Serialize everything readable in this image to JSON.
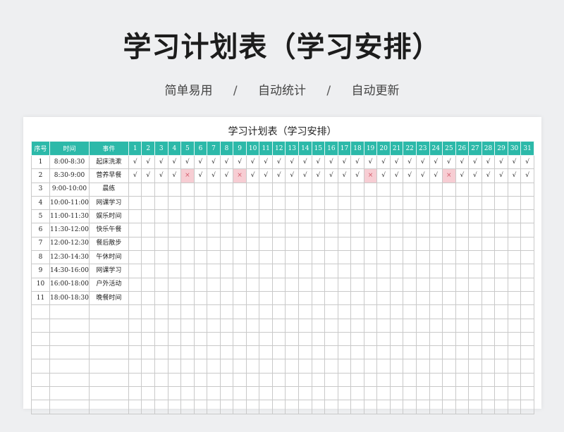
{
  "header": {
    "title": "学习计划表（学习安排）",
    "features": [
      "简单易用",
      "自动统计",
      "自动更新"
    ],
    "separator": "/"
  },
  "sheet": {
    "title": "学习计划表（学习安排）",
    "columns": {
      "index": "序号",
      "time": "时间",
      "event": "事件",
      "days": [
        "1",
        "2",
        "3",
        "4",
        "5",
        "6",
        "7",
        "8",
        "9",
        "10",
        "11",
        "12",
        "13",
        "14",
        "15",
        "16",
        "17",
        "18",
        "19",
        "20",
        "21",
        "22",
        "23",
        "24",
        "25",
        "26",
        "27",
        "28",
        "29",
        "30",
        "31"
      ]
    },
    "check_symbol": "√",
    "cross_symbol": "×",
    "rows": [
      {
        "index": "1",
        "time": "8:00-8:30",
        "event": "起床洗漱",
        "marks": [
          "√",
          "√",
          "√",
          "√",
          "√",
          "√",
          "√",
          "√",
          "√",
          "√",
          "√",
          "√",
          "√",
          "√",
          "√",
          "√",
          "√",
          "√",
          "√",
          "√",
          "√",
          "√",
          "√",
          "√",
          "√",
          "√",
          "√",
          "√",
          "√",
          "√",
          "√"
        ]
      },
      {
        "index": "2",
        "time": "8:30-9:00",
        "event": "营养早餐",
        "marks": [
          "√",
          "√",
          "√",
          "√",
          "×",
          "√",
          "√",
          "√",
          "×",
          "√",
          "√",
          "√",
          "√",
          "√",
          "√",
          "√",
          "√",
          "√",
          "×",
          "√",
          "√",
          "√",
          "√",
          "√",
          "×",
          "√",
          "√",
          "√",
          "√",
          "√",
          "√"
        ]
      },
      {
        "index": "3",
        "time": "9:00-10:00",
        "event": "晨练",
        "marks": []
      },
      {
        "index": "4",
        "time": "10:00-11:00",
        "event": "网课学习",
        "marks": []
      },
      {
        "index": "5",
        "time": "11:00-11:30",
        "event": "娱乐时间",
        "marks": []
      },
      {
        "index": "6",
        "time": "11:30-12:00",
        "event": "快乐午餐",
        "marks": []
      },
      {
        "index": "7",
        "time": "12:00-12:30",
        "event": "餐后散步",
        "marks": []
      },
      {
        "index": "8",
        "time": "12:30-14:30",
        "event": "午休时间",
        "marks": []
      },
      {
        "index": "9",
        "time": "14:30-16:00",
        "event": "网课学习",
        "marks": []
      },
      {
        "index": "10",
        "time": "16:00-18:00",
        "event": "户外活动",
        "marks": []
      },
      {
        "index": "11",
        "time": "18:00-18:30",
        "event": "晚餐时间",
        "marks": []
      }
    ],
    "empty_rows": 8,
    "colors": {
      "header_bg": "#2cb9a9",
      "cross_bg": "#f7cdd3",
      "cross_fg": "#d45a6a",
      "grid": "#c9c9c9"
    }
  }
}
